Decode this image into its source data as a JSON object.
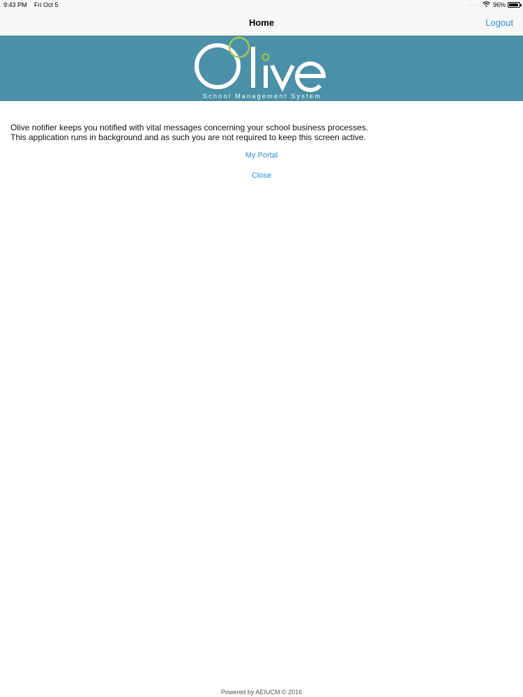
{
  "status_bar": {
    "time": "9:43 PM",
    "date": "Fri Oct 5",
    "battery": "96%",
    "battery_level": 0.96,
    "icons": [
      "wifi-icon",
      "battery-icon"
    ]
  },
  "nav": {
    "title": "Home",
    "logout_label": "Logout"
  },
  "banner": {
    "logo_text": "Olive",
    "logo_subtitle": "School Management System",
    "colors": {
      "background": "#4a90a8",
      "ring": "#a6c94a",
      "text": "#ffffff"
    }
  },
  "main": {
    "line1": "Olive notifier keeps you notified with vital messages concerning your school business processes.",
    "line2": "This application runs in background and as such you are not required to keep this screen active.",
    "portal_label": "My Portal",
    "close_label": "Close"
  },
  "footer": {
    "text": "Powered by AEIUCM © 2016"
  },
  "colors": {
    "accent": "#2f8fd8",
    "bar_bg": "#f7f7f7"
  }
}
